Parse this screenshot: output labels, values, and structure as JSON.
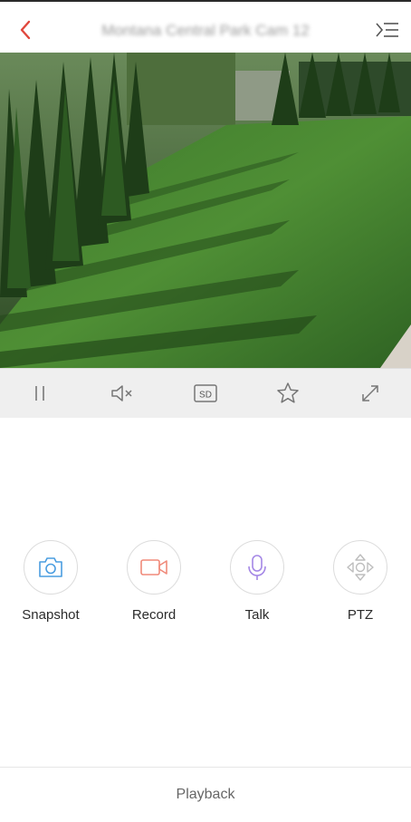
{
  "header": {
    "title": "Montana Central Park Cam 12",
    "back_icon": "chevron-left-icon",
    "menu_icon": "menu-list-icon",
    "accent_color": "#e0473c"
  },
  "controls": [
    {
      "name": "pause-button",
      "icon": "pause-icon"
    },
    {
      "name": "mute-button",
      "icon": "speaker-muted-icon"
    },
    {
      "name": "quality-button",
      "icon": "sd-icon",
      "label": "SD"
    },
    {
      "name": "favorite-button",
      "icon": "star-icon"
    },
    {
      "name": "fullscreen-button",
      "icon": "expand-icon"
    }
  ],
  "actions": [
    {
      "label": "Snapshot",
      "icon": "camera-icon",
      "color": "#4a9de0"
    },
    {
      "label": "Record",
      "icon": "video-camera-icon",
      "color": "#f08a7a"
    },
    {
      "label": "Talk",
      "icon": "microphone-icon",
      "color": "#a487e6"
    },
    {
      "label": "PTZ",
      "icon": "direction-pad-icon",
      "color": "#bdbdbd"
    }
  ],
  "footer": {
    "playback_label": "Playback"
  }
}
